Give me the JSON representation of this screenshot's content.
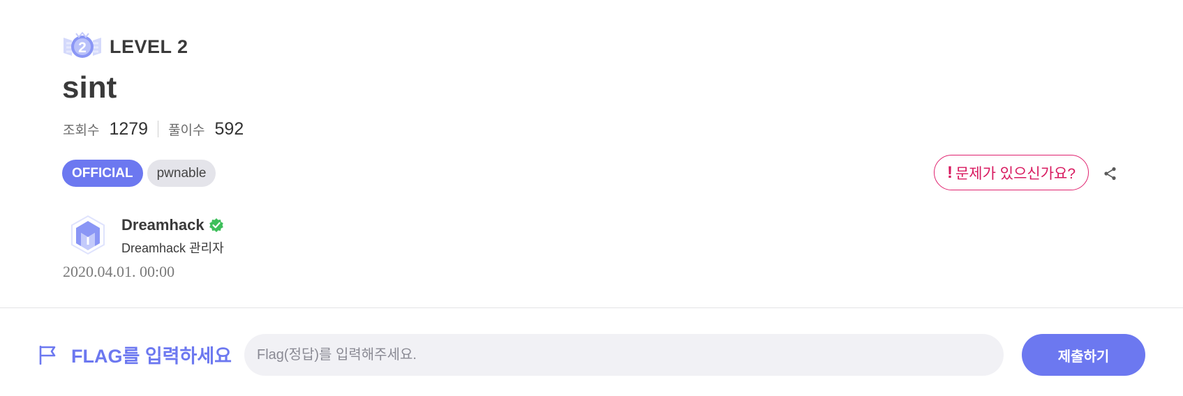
{
  "challenge": {
    "level_label": "LEVEL 2",
    "level_badge_number": "2",
    "title": "sint",
    "stats": {
      "views_label": "조회수",
      "views_value": "1279",
      "solves_label": "풀이수",
      "solves_value": "592"
    },
    "tags": [
      {
        "label": "OFFICIAL",
        "kind": "official"
      },
      {
        "label": "pwnable",
        "kind": "category"
      }
    ],
    "report_button": {
      "exclaim": "!",
      "label": "문제가 있으신가요?"
    },
    "share_icon": "share-icon",
    "author": {
      "name": "Dreamhack",
      "role": "Dreamhack 관리자",
      "verified_icon": "verified-check-icon",
      "avatar_icon": "dreamhack-logo-icon"
    },
    "date": "2020.04.01. 00:00"
  },
  "flag": {
    "icon": "flag-icon",
    "label": "FLAG를 입력하세요",
    "placeholder": "Flag(정답)를 입력해주세요.",
    "submit_label": "제출하기"
  },
  "colors": {
    "accent": "#6c78f0",
    "report": "#e0226f",
    "verified": "#3dbf5a",
    "tag_bg": "#e4e4ea",
    "input_bg": "#f1f1f5"
  }
}
